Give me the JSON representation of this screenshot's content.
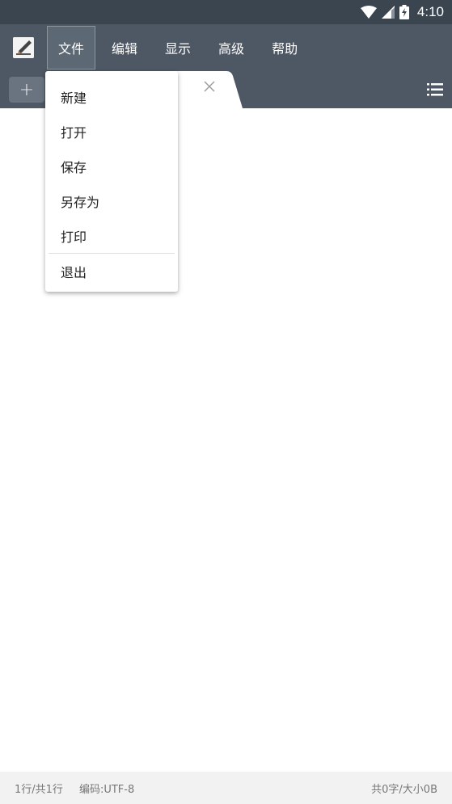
{
  "status_bar": {
    "time": "4:10",
    "icons": [
      "wifi-icon",
      "signal-icon",
      "battery-charging-icon"
    ]
  },
  "menu_bar": {
    "logo_icon": "text-editor-logo-icon",
    "items": [
      {
        "label": "文件",
        "active": true
      },
      {
        "label": "编辑",
        "active": false
      },
      {
        "label": "显示",
        "active": false
      },
      {
        "label": "高级",
        "active": false
      },
      {
        "label": "帮助",
        "active": false
      }
    ]
  },
  "tab_bar": {
    "add_label": "+",
    "close_icon": "close-icon",
    "menu_icon": "list-icon"
  },
  "file_menu": {
    "items": [
      {
        "label": "新建"
      },
      {
        "label": "打开"
      },
      {
        "label": "保存"
      },
      {
        "label": "另存为"
      },
      {
        "label": "打印"
      },
      {
        "label": "退出"
      }
    ]
  },
  "bottom_bar": {
    "line_info": "1行/共1行",
    "encoding": "编码:UTF-8",
    "size_info": "共0字/大小0B"
  },
  "colors": {
    "toolbar": "#4e5864",
    "status_bar": "#3b4550",
    "bottom_bar": "#f2f2f2"
  }
}
